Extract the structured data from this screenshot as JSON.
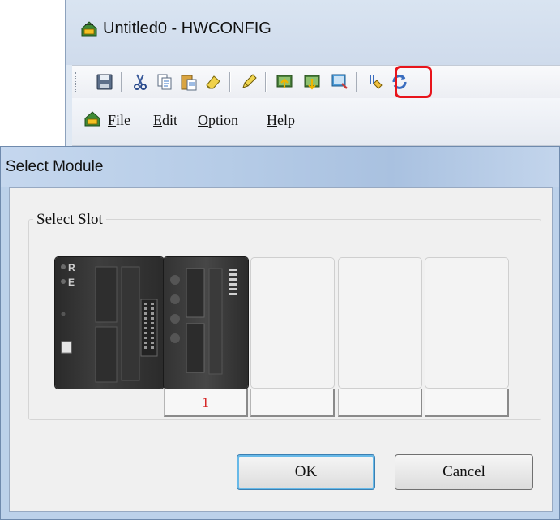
{
  "hwconfig": {
    "window_title": "Untitled0 - HWCONFIG",
    "toolbar": {
      "icons": [
        "save-icon",
        "cut-icon",
        "copy-icon",
        "paste-icon",
        "erase-icon",
        "edit-icon",
        "upload-icon",
        "download-icon",
        "scan-icon",
        "settings-icon",
        "refresh-icon"
      ],
      "highlighted": "download-icon",
      "highlight_color": "#e8141b"
    },
    "menu": {
      "items": [
        {
          "underline": "F",
          "rest": "ile"
        },
        {
          "underline": "E",
          "rest": "dit"
        },
        {
          "underline": "O",
          "rest": "ption"
        },
        {
          "underline": "H",
          "rest": "elp"
        }
      ]
    }
  },
  "dialog": {
    "title": "Select Module",
    "group_label": "Select Slot",
    "cpu_leds": [
      "R",
      "E"
    ],
    "slots": [
      {
        "label": "1"
      },
      {
        "label": ""
      },
      {
        "label": ""
      },
      {
        "label": ""
      }
    ],
    "slot_label_color": "#d62828",
    "ok_label": "OK",
    "cancel_label": "Cancel"
  }
}
